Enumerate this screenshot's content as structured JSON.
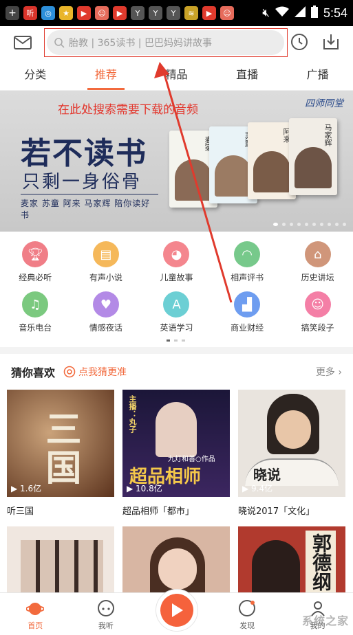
{
  "status_bar": {
    "time": "5:54"
  },
  "top_bar": {
    "search_placeholder": "胎教 | 365读书 | 巴巴妈妈讲故事"
  },
  "tabs": [
    {
      "label": "分类",
      "active": false
    },
    {
      "label": "推荐",
      "active": true
    },
    {
      "label": "精品",
      "active": false
    },
    {
      "label": "直播",
      "active": false
    },
    {
      "label": "广播",
      "active": false
    }
  ],
  "annotation": "在此处搜索需要下载的音频",
  "banner": {
    "brand": "四师同堂",
    "title": "若不读书",
    "subtitle": "只剩一身俗骨",
    "names": "麦家 苏童 阿来 马家辉 陪你读好书",
    "books": [
      "麦家",
      "苏童",
      "阿来",
      "马家辉"
    ]
  },
  "categories": [
    {
      "label": "经典必听",
      "color": "#f07e87",
      "icon": "trophy-icon"
    },
    {
      "label": "有声小说",
      "color": "#f5b85a",
      "icon": "book-icon"
    },
    {
      "label": "儿童故事",
      "color": "#f4868e",
      "icon": "pig-icon"
    },
    {
      "label": "相声评书",
      "color": "#77c98b",
      "icon": "fan-icon"
    },
    {
      "label": "历史讲坛",
      "color": "#d0967a",
      "icon": "pavilion-icon"
    },
    {
      "label": "音乐电台",
      "color": "#7bc97f",
      "icon": "music-note-icon"
    },
    {
      "label": "情感夜话",
      "color": "#b38ae6",
      "icon": "heart-icon"
    },
    {
      "label": "英语学习",
      "color": "#6ccfd4",
      "icon": "letter-a-icon"
    },
    {
      "label": "商业财经",
      "color": "#6e9df0",
      "icon": "chart-icon"
    },
    {
      "label": "搞笑段子",
      "color": "#f47fa6",
      "icon": "smile-icon"
    }
  ],
  "guess": {
    "title": "猜你喜欢",
    "hint": "点我猜更准",
    "more": "更多"
  },
  "albums": [
    {
      "name": "听三国",
      "plays": "1.6亿",
      "cover_text": "三国",
      "bg": "#6b3f24"
    },
    {
      "name": "超品相师「都市」",
      "plays": "10.8亿",
      "cover_text": "超品相师",
      "sub": "九灯和善○作品",
      "tag": "主播：丸子",
      "bg": "#2a1e4a"
    },
    {
      "name": "晓说2017「文化」",
      "plays": "9.4亿",
      "cover_text": "晓说",
      "bg": "#e6e1dc"
    }
  ],
  "albums_row2": [
    {
      "bg": "#e8d9cf"
    },
    {
      "bg": "#d9b9a7"
    },
    {
      "bg": "#b13a2e",
      "cover_text": "郭德纲"
    }
  ],
  "bottom_nav": [
    {
      "label": "首页",
      "active": true,
      "icon": "home-planet-icon"
    },
    {
      "label": "我听",
      "active": false,
      "icon": "headphones-icon"
    },
    {
      "label": "",
      "active": false,
      "icon": "play-icon"
    },
    {
      "label": "发现",
      "active": false,
      "icon": "discover-icon"
    },
    {
      "label": "我的",
      "active": false,
      "icon": "profile-icon"
    }
  ],
  "watermark": "系统之家"
}
